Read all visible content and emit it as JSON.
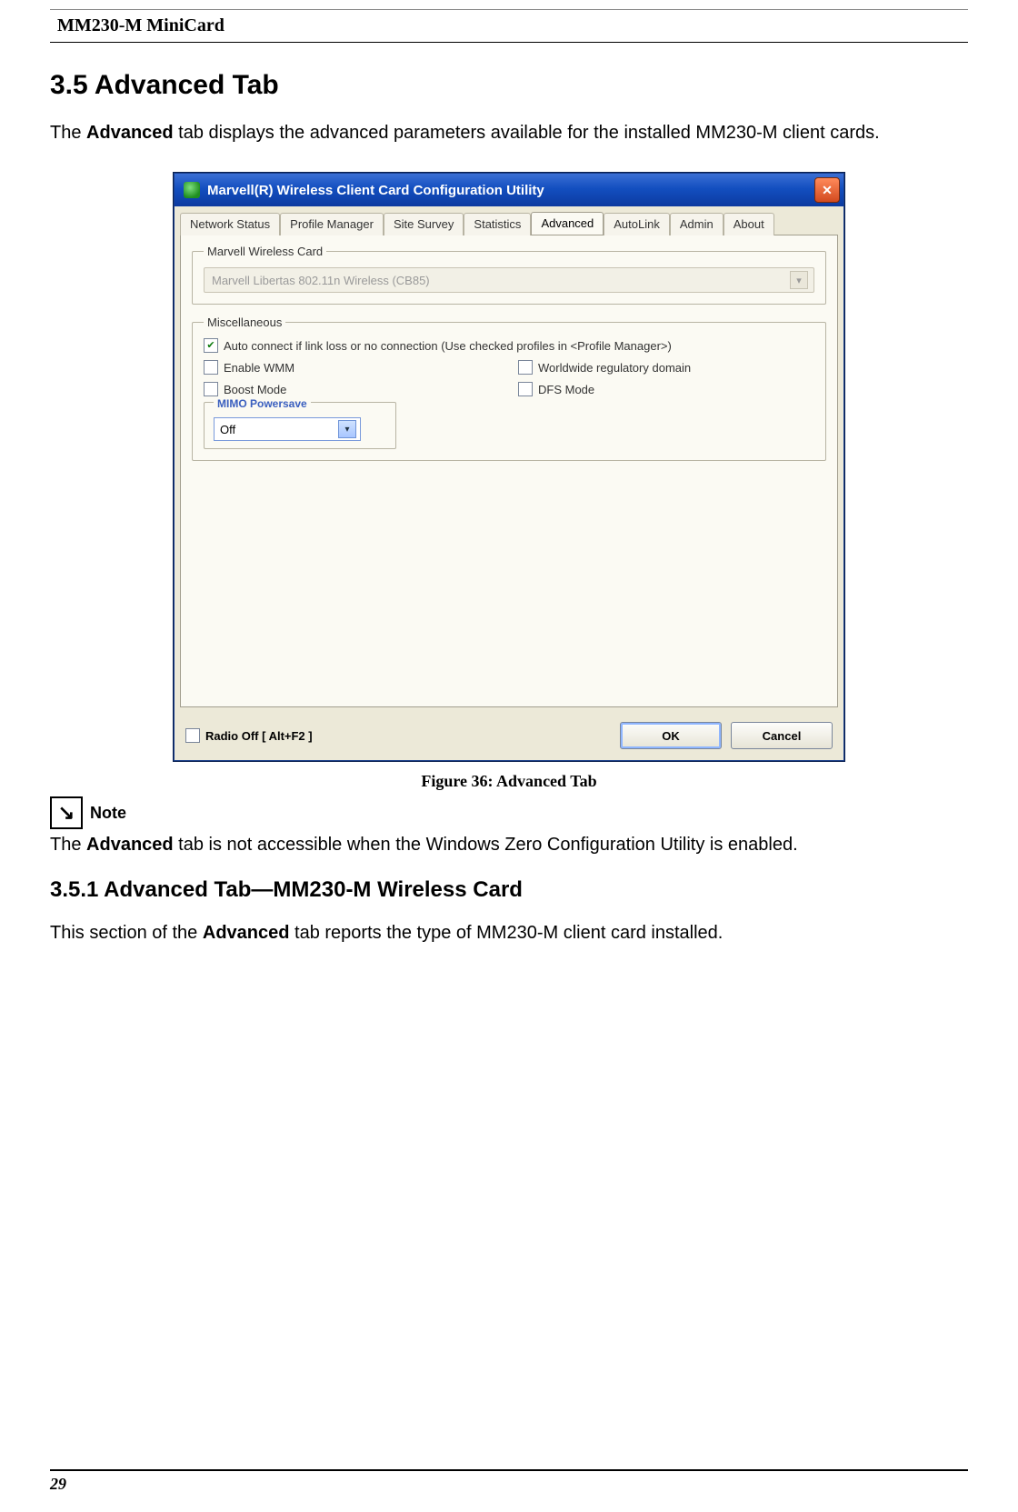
{
  "header": {
    "doc_title": "MM230-M MiniCard"
  },
  "section": {
    "number_title": "3.5 Advanced Tab",
    "intro_pre": "The ",
    "intro_bold": "Advanced",
    "intro_post": " tab displays the advanced parameters available for the installed MM230-M client cards."
  },
  "dialog": {
    "title": "Marvell(R) Wireless Client Card Configuration Utility",
    "close_glyph": "✕",
    "tabs": {
      "network_status": "Network Status",
      "profile_manager": "Profile Manager",
      "site_survey": "Site Survey",
      "statistics": "Statistics",
      "advanced": "Advanced",
      "autolink": "AutoLink",
      "admin": "Admin",
      "about": "About"
    },
    "card_group": {
      "legend": "Marvell Wireless Card",
      "selected": "Marvell Libertas 802.11n Wireless (CB85)"
    },
    "misc": {
      "legend": "Miscellaneous",
      "auto_connect": "Auto connect if link loss or no connection (Use checked profiles in <Profile Manager>)",
      "enable_wmm": "Enable WMM",
      "worldwide": "Worldwide regulatory domain",
      "boost": "Boost Mode",
      "dfs": "DFS Mode"
    },
    "mimo": {
      "legend": "MIMO Powersave",
      "value": "Off"
    },
    "bottom": {
      "radio_off": "Radio Off  [ Alt+F2 ]",
      "ok": "OK",
      "cancel": "Cancel"
    }
  },
  "figure": {
    "caption": "Figure 36: Advanced Tab"
  },
  "note": {
    "icon_glyph": "↘",
    "label": "Note",
    "text_pre": "The ",
    "text_bold": "Advanced",
    "text_post": " tab is not accessible when the Windows Zero Configuration Utility is enabled."
  },
  "subsection": {
    "number_title": "3.5.1 Advanced Tab—MM230-M Wireless Card",
    "body_pre": "This section of the ",
    "body_bold": "Advanced",
    "body_post": " tab reports the type of MM230-M client card installed."
  },
  "footer": {
    "page_number": "29"
  }
}
